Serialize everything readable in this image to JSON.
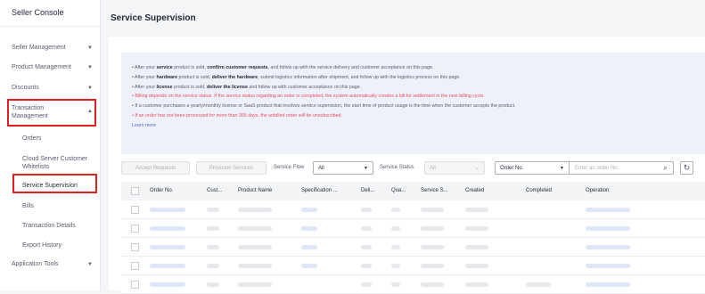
{
  "sidebar": {
    "title": "Seller Console",
    "menu": [
      {
        "label": "Seller Management",
        "chevron": "chevron-down-icon"
      },
      {
        "label": "Product Management",
        "chevron": "chevron-down-icon"
      },
      {
        "label": "Discounts",
        "chevron": "chevron-down-icon"
      },
      {
        "label": "Transaction Management",
        "chevron": "chevron-up-icon"
      }
    ],
    "transaction_sub": [
      "Orders",
      "Cloud Server Customer Whitelists",
      "Service Supervision",
      "Bills",
      "Transaction Details",
      "Export History"
    ],
    "application_tools": "Application Tools",
    "highlight_color": "#e02020"
  },
  "page": {
    "title": "Service Supervision"
  },
  "notice": {
    "l1": {
      "a": "• After your ",
      "b": "service",
      "c": " product is sold, ",
      "d": "confirm customer requests",
      "e": ", and follow up with the service delivery and customer acceptance on this page."
    },
    "l2": {
      "a": "• After your ",
      "b": "hardware",
      "c": " product is sold, ",
      "d": "deliver the hardware",
      "e": ", submit logistics information after shipment, and follow up with the logistics process on this page."
    },
    "l3": {
      "a": "• After your ",
      "b": "license",
      "c": " product is sold, ",
      "d": "deliver the license",
      "e": " and follow up with customer acceptance on this page."
    },
    "l4": "• Billing depends on the service status. If the service status regarding an order is completed, the system automatically creates a bill for settlement in the next billing cycle.",
    "l5": "• If a customer purchases a yearly/monthly license or SaaS product that involves service supervision, the start time of product usage is the time when the customer accepts the product.",
    "l6": "• If an order has not been processed for more than 365 days, the unbilled order will be unsubscribed.",
    "learn_more": "Learn more"
  },
  "toolbar": {
    "accept_requests": "Accept Requests",
    "provision_services": "Provision Services",
    "service_flow_label": "Service Flow",
    "service_flow_value": "All",
    "service_status_label": "Service Status",
    "service_status_value": "All",
    "search_field": "Order No.",
    "search_placeholder": "Enter an order No."
  },
  "table": {
    "headers": [
      "Order No.",
      "Cust...",
      "Product Name",
      "Specification ...",
      "Deli...",
      "Qua...",
      "Service S...",
      "Created",
      "Completed",
      "Operation"
    ],
    "rows": 5
  }
}
